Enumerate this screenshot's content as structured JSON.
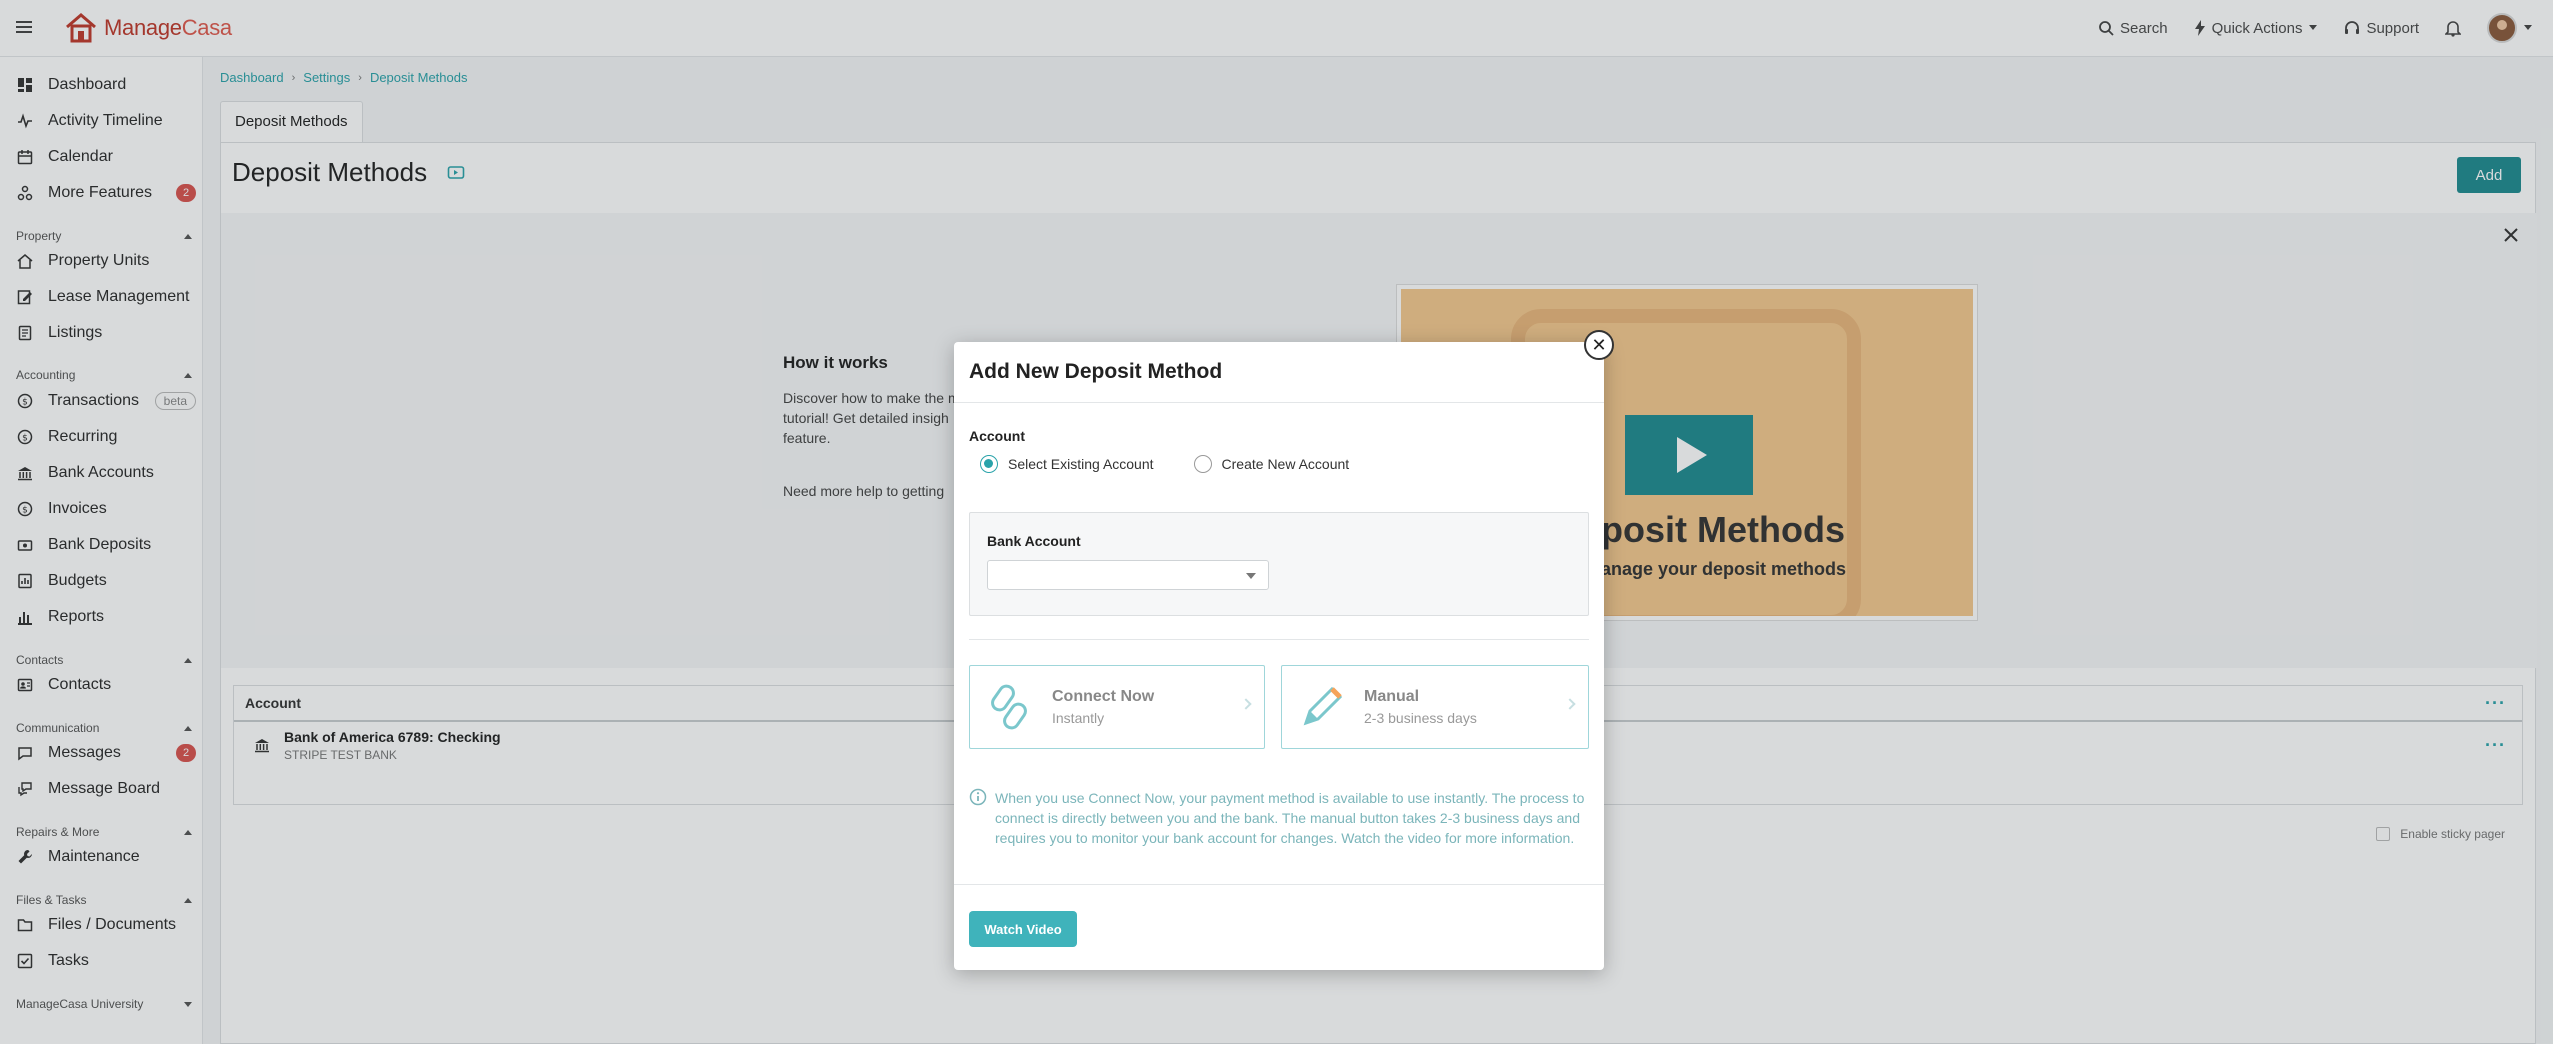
{
  "brand": {
    "name_part1": "Manage",
    "name_part2": "Casa"
  },
  "topbar": {
    "search": "Search",
    "quick_actions": "Quick Actions",
    "support": "Support"
  },
  "sidebar": {
    "items": [
      {
        "label": "Dashboard"
      },
      {
        "label": "Activity Timeline"
      },
      {
        "label": "Calendar"
      },
      {
        "label": "More Features",
        "badge": "2"
      },
      {
        "label": "Property Units"
      },
      {
        "label": "Lease Management"
      },
      {
        "label": "Listings"
      },
      {
        "label": "Transactions",
        "tag": "beta"
      },
      {
        "label": "Recurring"
      },
      {
        "label": "Bank Accounts"
      },
      {
        "label": "Invoices"
      },
      {
        "label": "Bank Deposits"
      },
      {
        "label": "Budgets"
      },
      {
        "label": "Reports"
      },
      {
        "label": "Contacts"
      },
      {
        "label": "Messages",
        "badge": "2"
      },
      {
        "label": "Message Board"
      },
      {
        "label": "Maintenance"
      },
      {
        "label": "Files / Documents"
      },
      {
        "label": "Tasks"
      }
    ],
    "sections": {
      "property": "Property",
      "accounting": "Accounting",
      "contacts": "Contacts",
      "communication": "Communication",
      "repairs": "Repairs & More",
      "files": "Files & Tasks",
      "university": "ManageCasa University"
    }
  },
  "breadcrumb": [
    "Dashboard",
    "Settings",
    "Deposit Methods"
  ],
  "tab": "Deposit Methods",
  "page": {
    "title": "Deposit Methods",
    "add_label": "Add"
  },
  "howto": {
    "title": "How it works",
    "text": "Discover how to make the m tutorial! Get detailed insigh feature.",
    "help": "Need more help to getting",
    "video_title": "posit Methods",
    "video_sub": "anage your deposit methods"
  },
  "table": {
    "header": "Account",
    "row": {
      "name": "Bank of America 6789: Checking",
      "sub": "STRIPE TEST BANK"
    }
  },
  "sticky": "Enable sticky pager",
  "modal": {
    "title": "Add New Deposit Method",
    "account_label": "Account",
    "radio_existing": "Select Existing Account",
    "radio_new": "Create New Account",
    "bank_label": "Bank Account",
    "bank_value": "",
    "connect_title": "Connect Now",
    "connect_sub": "Instantly",
    "manual_title": "Manual",
    "manual_sub": "2-3 business days",
    "info": "When you use Connect Now, your payment method is available to use instantly. The process to connect is directly between you and the bank. The manual button takes 2-3 business days and requires you to monitor your bank account for changes. Watch the video for more information.",
    "watch_label": "Watch Video",
    "close_glyph": "✕"
  },
  "colors": {
    "accent": "#2aa3aa",
    "brand": "#c0392b",
    "badge": "#d9534f"
  }
}
